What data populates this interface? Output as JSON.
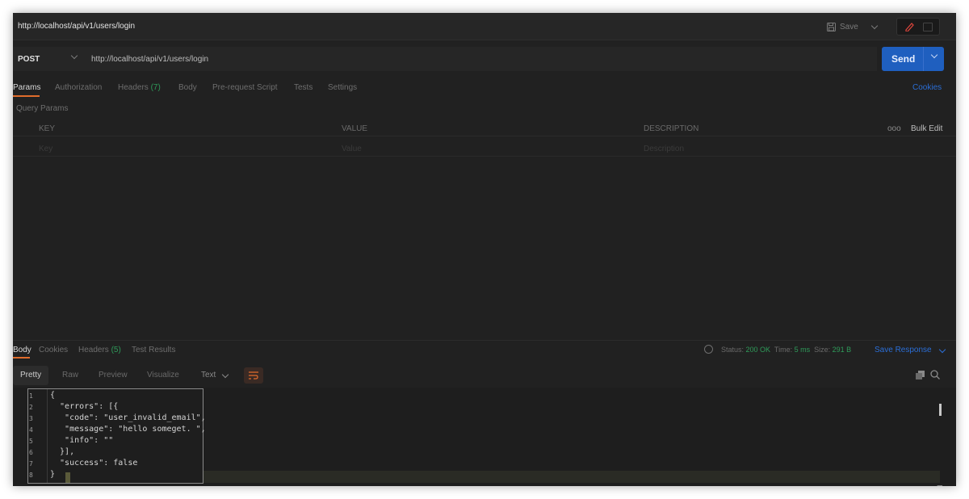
{
  "window": {
    "title": "http://localhost/api/v1/users/login"
  },
  "toolbar": {
    "save_label": "Save"
  },
  "request": {
    "method": "POST",
    "url": "http://localhost/api/v1/users/login",
    "send_label": "Send"
  },
  "request_tabs": [
    {
      "label": "Params"
    },
    {
      "label": "Authorization"
    },
    {
      "label": "Headers",
      "count": "(7)"
    },
    {
      "label": "Body"
    },
    {
      "label": "Pre-request Script"
    },
    {
      "label": "Tests"
    },
    {
      "label": "Settings"
    }
  ],
  "cookies_label": "Cookies",
  "query_params": {
    "title": "Query Params",
    "columns": [
      "KEY",
      "VALUE",
      "DESCRIPTION"
    ],
    "placeholders": [
      "Key",
      "Value",
      "Description"
    ],
    "bulk_edit_label": "Bulk Edit",
    "more_icon": "ooo"
  },
  "response": {
    "tabs": [
      {
        "label": "Body"
      },
      {
        "label": "Cookies"
      },
      {
        "label": "Headers",
        "count": "(5)"
      },
      {
        "label": "Test Results"
      }
    ],
    "status_label": "Status:",
    "status_value": "200 OK",
    "time_label": "Time:",
    "time_value": "5 ms",
    "size_label": "Size:",
    "size_value": "291 B",
    "save_response_label": "Save Response",
    "format_tabs": [
      "Pretty",
      "Raw",
      "Preview",
      "Visualize"
    ],
    "format_type": "Text",
    "code_lines": [
      "{",
      "  \"errors\": [{",
      "   \"code\": \"user_invalid_email\",",
      "   \"message\": \"hello someget. \",",
      "   \"info\": \"\"",
      "  }],",
      "  \"success\": false",
      "}"
    ],
    "line_numbers": [
      "1",
      "2",
      "3",
      "4",
      "5",
      "6",
      "7",
      "8"
    ]
  },
  "colors": {
    "accent": "#e06c2c",
    "send_button": "#1f5fbf",
    "link": "#2b6ed6",
    "success": "#2f9b5a"
  }
}
